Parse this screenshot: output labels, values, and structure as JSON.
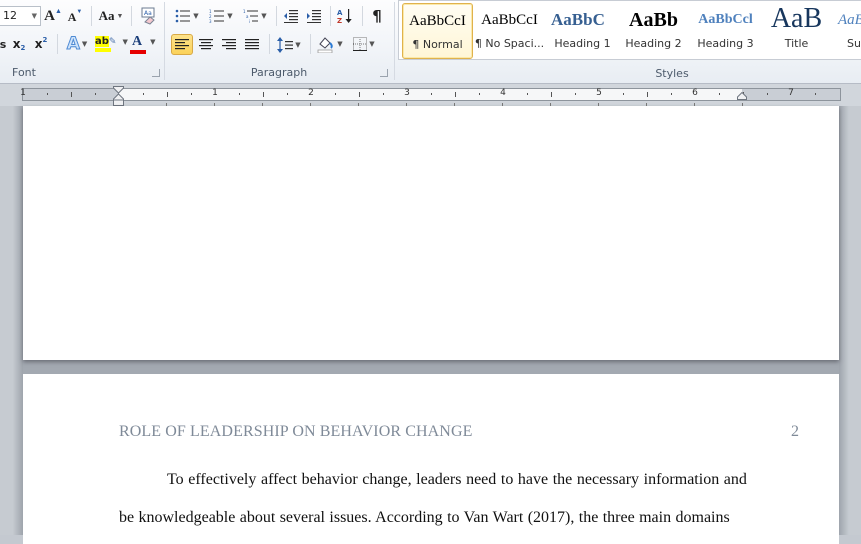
{
  "ribbon": {
    "font_group": {
      "label": "Font",
      "font_size": "12",
      "grow_font_icon": "A",
      "shrink_font_icon": "A",
      "change_case_label": "Aa",
      "subscript_label": "x",
      "superscript_label": "x",
      "text_effects_label": "A",
      "highlight_label": "ab",
      "font_color_label": "A",
      "highlight_color": "#ffff00",
      "font_color": "#e60000"
    },
    "paragraph_group": {
      "label": "Paragraph",
      "sort_label": "A Z",
      "pilcrow": "¶"
    },
    "styles_group": {
      "label": "Styles",
      "items": [
        {
          "sample": "AaBbCcI",
          "name": "¶ Normal",
          "selected": true
        },
        {
          "sample": "AaBbCcI",
          "name": "¶ No Spaci..."
        },
        {
          "sample": "AaBbC",
          "name": "Heading 1"
        },
        {
          "sample": "AaBb",
          "name": "Heading 2"
        },
        {
          "sample": "AaBbCcl",
          "name": "Heading 3"
        },
        {
          "sample": "AaB",
          "name": "Title"
        },
        {
          "sample": "AaB",
          "name": "Su"
        }
      ]
    }
  },
  "ruler": {
    "numbers": [
      "1",
      "1",
      "2",
      "3",
      "4",
      "5",
      "6",
      "7"
    ]
  },
  "document": {
    "page2": {
      "header": "ROLE OF LEADERSHIP ON BEHAVIOR CHANGE",
      "page_number": "2",
      "lines": [
        "To effectively affect behavior change, leaders need to have the necessary information and",
        "be knowledgeable about several issues. According to Van Wart (2017), the three main domains"
      ]
    }
  },
  "colors": {
    "accent_selected": "#fbd25a",
    "heading_blue": "#365f91",
    "header_gray": "#7f8a98"
  }
}
